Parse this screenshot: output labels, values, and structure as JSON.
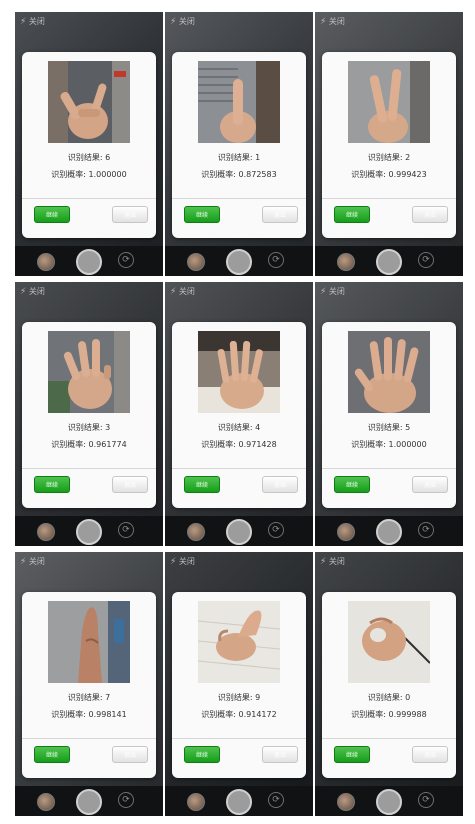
{
  "common": {
    "flash_label": "关闭",
    "continue_label": "继续",
    "exit_label": "退出",
    "colors": {
      "continue_button": "#169e1a",
      "dialog_background": "#fafafa",
      "camera_bar": "#111214"
    },
    "icons": [
      "flash-icon",
      "gallery-thumbnail",
      "shutter-button",
      "switch-camera-icon"
    ]
  },
  "screens": [
    {
      "result": "识别结果: 6",
      "probability": "识别概率: 1.000000",
      "gesture": "pinky-and-thumb out, others folded"
    },
    {
      "result": "识别结果: 1",
      "probability": "识别概率: 0.872583",
      "gesture": "one finger up"
    },
    {
      "result": "识别结果: 2",
      "probability": "识别概率: 0.999423",
      "gesture": "two fingers up"
    },
    {
      "result": "识别结果: 3",
      "probability": "识别概率: 0.961774",
      "gesture": "three fingers up"
    },
    {
      "result": "识别结果: 4",
      "probability": "识别概率: 0.971428",
      "gesture": "four fingers up"
    },
    {
      "result": "识别结果: 5",
      "probability": "识别概率: 1.000000",
      "gesture": "open palm"
    },
    {
      "result": "识别结果: 7",
      "probability": "识别概率: 0.998141",
      "gesture": "pinched fingertips pointing up"
    },
    {
      "result": "识别结果: 9",
      "probability": "识别概率: 0.914172",
      "gesture": "hooked index finger"
    },
    {
      "result": "识别结果: 0",
      "probability": "识别概率: 0.999988",
      "gesture": "closed fist / zero"
    }
  ]
}
